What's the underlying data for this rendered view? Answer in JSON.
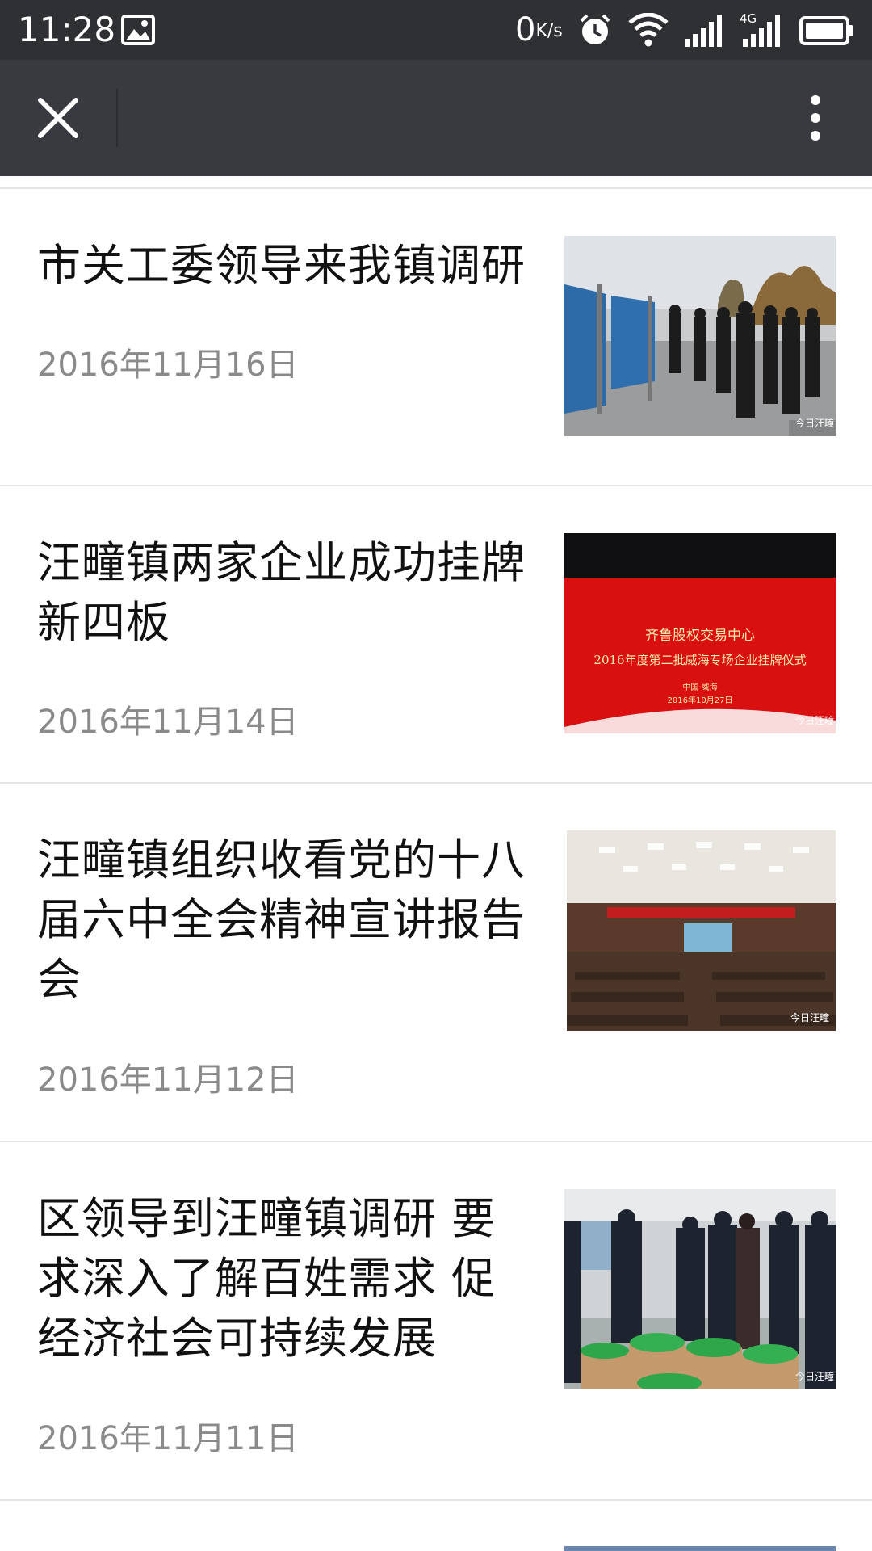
{
  "status_bar": {
    "time": "11:28",
    "net_speed_value": "0",
    "net_speed_unit": "K/s",
    "network_label": "4G"
  },
  "nav": {
    "close_icon": "close-icon",
    "more_icon": "more-vertical-icon"
  },
  "articles": [
    {
      "title": "市关工委领导来我镇调研",
      "date": "2016年11月16日",
      "thumb_watermark": "今日汪疃"
    },
    {
      "title": "汪疃镇两家企业成功挂牌新四板",
      "date": "2016年11月14日",
      "thumb_line1": "齐鲁股权交易中心",
      "thumb_line2": "2016年度第二批威海专场企业挂牌仪式",
      "thumb_line3": "中国·威海",
      "thumb_line4": "2016年10月27日",
      "thumb_watermark": "今日汪疃"
    },
    {
      "title": "汪疃镇组织收看党的十八届六中全会精神宣讲报告会",
      "date": "2016年11月12日",
      "thumb_watermark": "今日汪疃"
    },
    {
      "title": "区领导到汪疃镇调研 要求深入了解百姓需求 促经济社会可持续发展",
      "date": "2016年11月11日",
      "thumb_watermark": "今日汪疃"
    }
  ],
  "colors": {
    "status_bar_bg": "#2f3033",
    "nav_bar_bg": "#393a3f",
    "title_text": "#111111",
    "date_text": "#8a8a8a",
    "separator": "#e4e4e4"
  }
}
